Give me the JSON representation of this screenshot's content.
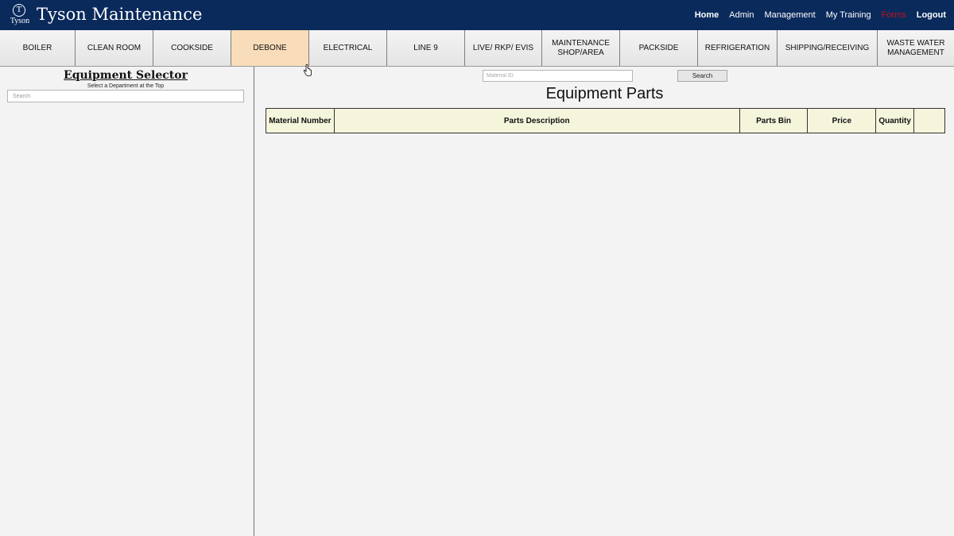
{
  "header": {
    "logo_letter": "T",
    "logo_word": "Tyson",
    "title": "Tyson Maintenance",
    "nav": [
      {
        "label": "Home",
        "bold": true
      },
      {
        "label": "Admin"
      },
      {
        "label": "Management"
      },
      {
        "label": "My Training"
      },
      {
        "label": "Forms"
      },
      {
        "label": "Logout",
        "bold": true
      }
    ]
  },
  "departments": [
    "BOILER",
    "CLEAN ROOM",
    "COOKSIDE",
    "DEBONE",
    "ELECTRICAL",
    "LINE 9",
    "LIVE/ RKP/ EVIS",
    "MAINTENANCE SHOP/AREA",
    "PACKSIDE",
    "REFRIGERATION",
    "SHIPPING/RECEIVING",
    "WASTE WATER MANAGEMENT"
  ],
  "active_department": "DEBONE",
  "selector": {
    "title": "Equipment Selector",
    "subtitle": "Select a Department at the Top",
    "search_placeholder": "Search"
  },
  "parts": {
    "material_placeholder": "Material ID",
    "search_label": "Search",
    "title": "Equipment Parts",
    "columns": [
      "Material Number",
      "Parts Description",
      "Parts Bin",
      "Price",
      "Quantity",
      ""
    ]
  },
  "colors": {
    "header_bg": "#0a2a5c",
    "active_tab": "#f9dcb9",
    "table_header_bg": "#f5f5dc",
    "forms_link": "#c4121f"
  }
}
